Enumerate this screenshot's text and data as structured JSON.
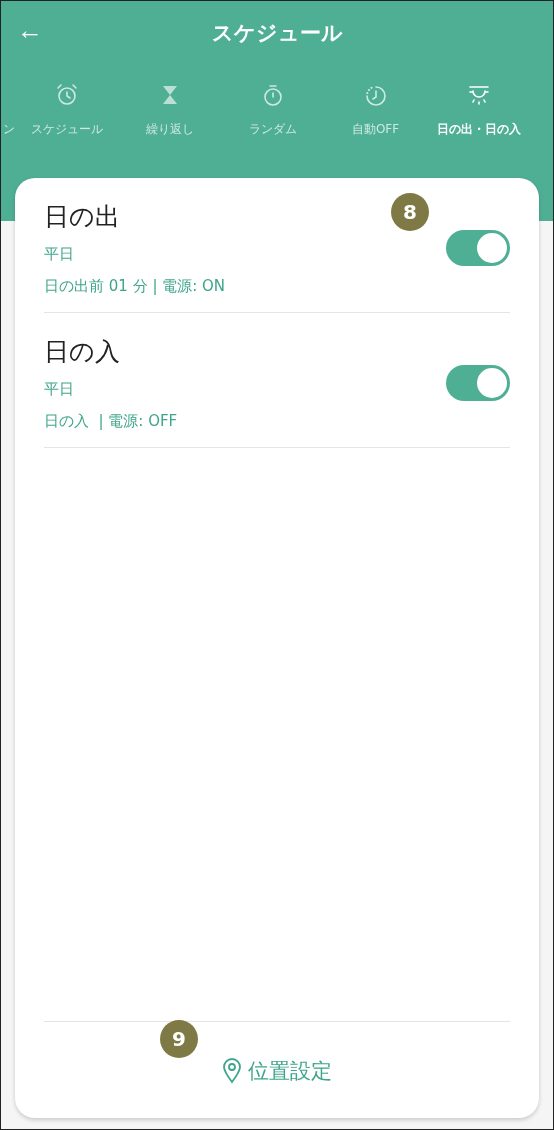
{
  "header": {
    "back": "←",
    "title": "スケジュール"
  },
  "tabs": [
    {
      "label": "ン",
      "kind": "partial",
      "selected": false
    },
    {
      "label": "スケジュール",
      "kind": "alarm",
      "selected": false
    },
    {
      "label": "繰り返し",
      "kind": "hourglass",
      "selected": false
    },
    {
      "label": "ランダム",
      "kind": "stopwatch",
      "selected": false
    },
    {
      "label": "自動OFF",
      "kind": "timer",
      "selected": false
    },
    {
      "label": "日の出・日の入",
      "kind": "sun",
      "selected": true
    }
  ],
  "schedules": [
    {
      "title": "日の出",
      "days": "平日",
      "detail": "日の出前 01 分 | 電源: ON",
      "on": true
    },
    {
      "title": "日の入",
      "days": "平日",
      "detail": "日の入  | 電源: OFF",
      "on": true
    }
  ],
  "location_button": "位置設定",
  "badges": [
    "8",
    "9"
  ]
}
